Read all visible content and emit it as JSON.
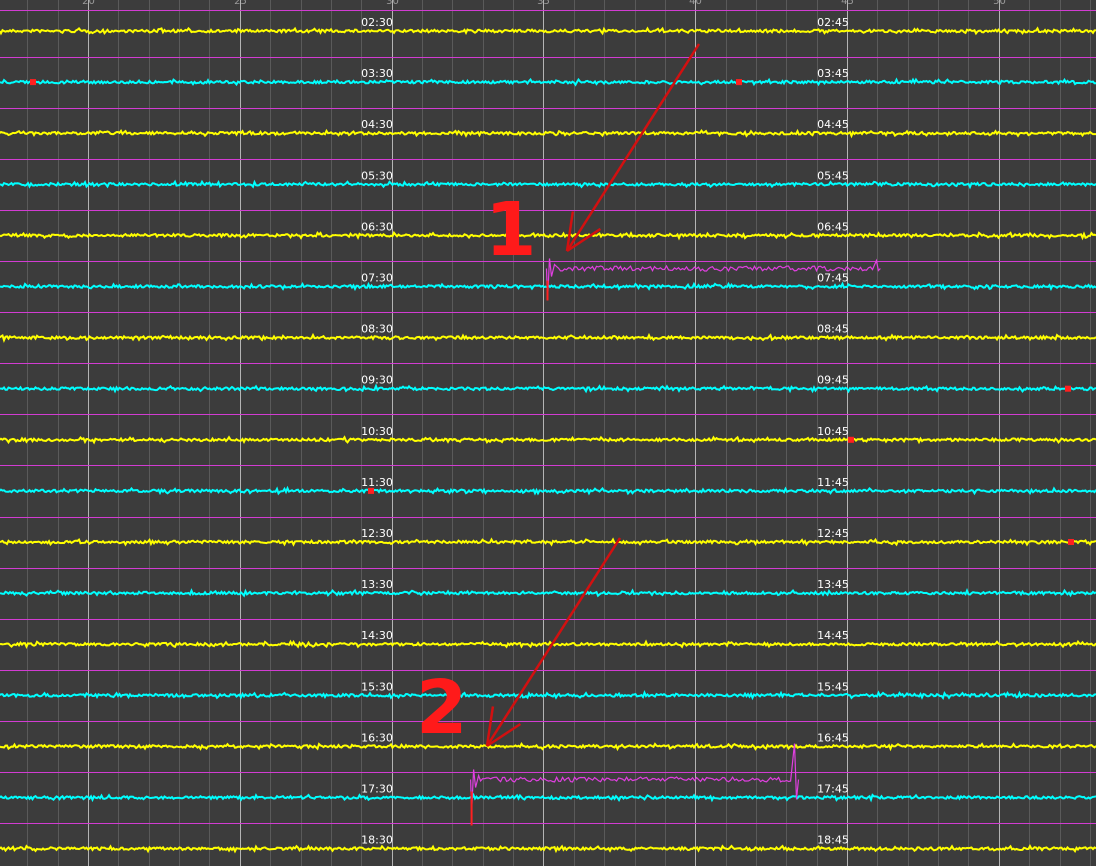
{
  "chart_data": {
    "type": "line",
    "title": "",
    "xlabel": "",
    "ylabel": "",
    "x_ticks": [
      20,
      25,
      30,
      35,
      40,
      45,
      50
    ],
    "xlim": [
      17.1,
      53.2
    ],
    "grid": true,
    "rows": [
      {
        "left": "02:30",
        "right": "02:45",
        "color": "#ffff00"
      },
      {
        "left": "03:30",
        "right": "03:45",
        "color": "#00ffff"
      },
      {
        "left": "04:30",
        "right": "04:45",
        "color": "#ffff00"
      },
      {
        "left": "05:30",
        "right": "05:45",
        "color": "#00ffff"
      },
      {
        "left": "06:30",
        "right": "06:45",
        "color": "#ffff00"
      },
      {
        "left": "07:30",
        "right": "07:45",
        "color": "#00ffff"
      },
      {
        "left": "08:30",
        "right": "08:45",
        "color": "#ffff00"
      },
      {
        "left": "09:30",
        "right": "09:45",
        "color": "#00ffff"
      },
      {
        "left": "10:30",
        "right": "10:45",
        "color": "#ffff00"
      },
      {
        "left": "11:30",
        "right": "11:45",
        "color": "#00ffff"
      },
      {
        "left": "12:30",
        "right": "12:45",
        "color": "#ffff00"
      },
      {
        "left": "13:30",
        "right": "13:45",
        "color": "#00ffff"
      },
      {
        "left": "14:30",
        "right": "14:45",
        "color": "#ffff00"
      },
      {
        "left": "15:30",
        "right": "15:45",
        "color": "#00ffff"
      },
      {
        "left": "16:30",
        "right": "16:45",
        "color": "#ffff00"
      },
      {
        "left": "17:30",
        "right": "17:45",
        "color": "#00ffff"
      },
      {
        "left": "18:30",
        "right": "18:45",
        "color": "#ffff00"
      }
    ],
    "events": [
      {
        "label": "1",
        "row": "07:30",
        "start": 35.1,
        "end": 46.1
      },
      {
        "label": "2",
        "row": "17:30",
        "start": 32.6,
        "end": 43.4
      }
    ],
    "colors": {
      "background": "#3c3c3c",
      "major_grid": "#b4b4b4",
      "minor_grid": "#5a5a5a",
      "separator": "#d23cd2",
      "trace_yellow": "#ffff00",
      "trace_cyan": "#00ffff",
      "event_trace": "#e040e0",
      "annotation": "#d21010",
      "marker_text": "#ff1a1a"
    }
  }
}
